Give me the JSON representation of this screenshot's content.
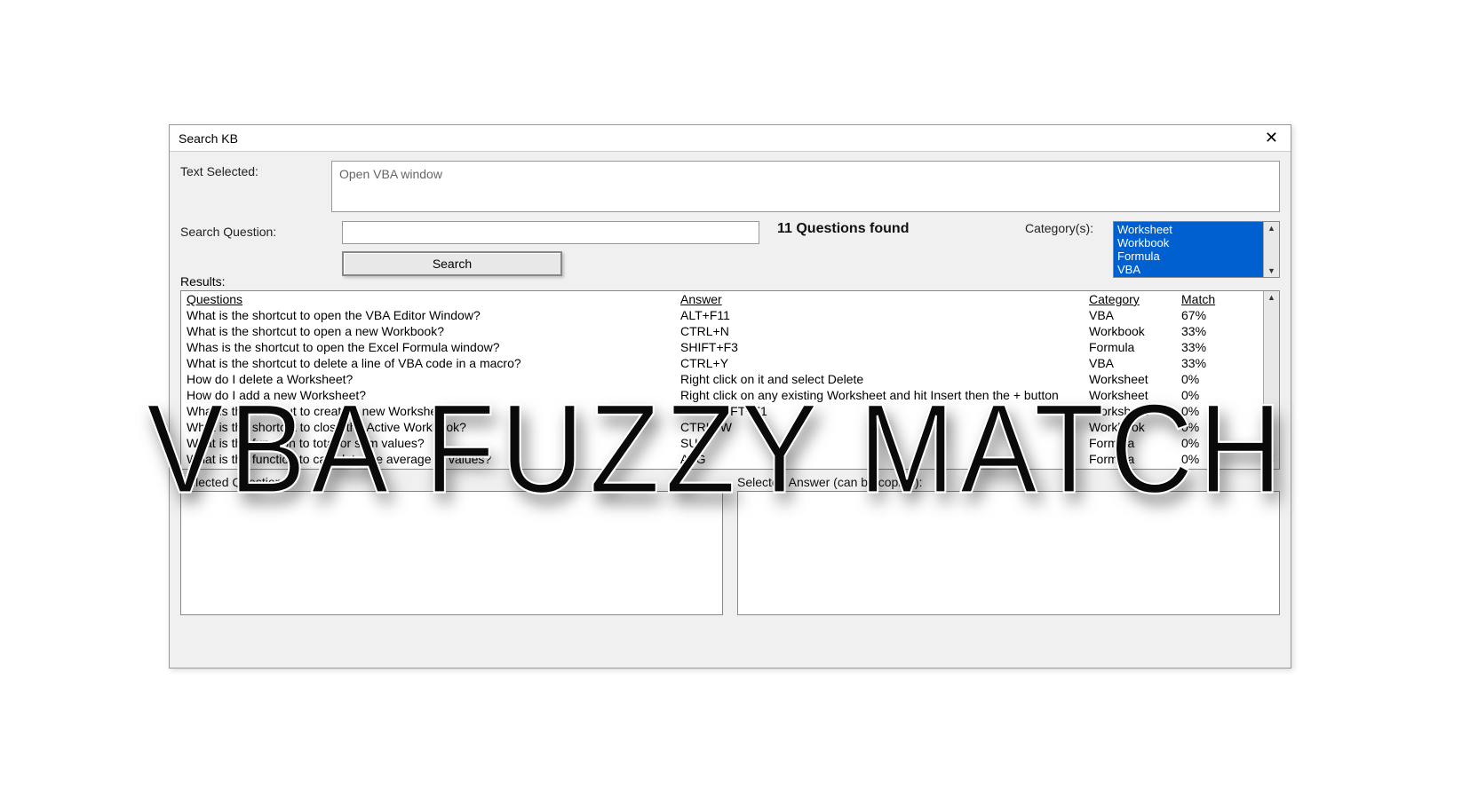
{
  "window": {
    "title": "Search KB"
  },
  "labels": {
    "text_selected": "Text Selected:",
    "search_question": "Search Question:",
    "category": "Category(s):",
    "results": "Results:",
    "selected_question": "Selected Question:",
    "selected_answer": "Selected Answer (can be copied):"
  },
  "text_selected_value": "Open VBA window",
  "search_question_value": "",
  "questions_found": "11 Questions found",
  "search_button": "Search",
  "categories": [
    "Worksheet",
    "Workbook",
    "Formula",
    "VBA"
  ],
  "results_headers": {
    "q": "Questions",
    "a": "Answer",
    "c": "Category",
    "m": "Match"
  },
  "results": [
    {
      "q": "What is the shortcut to open the VBA Editor Window?",
      "a": "ALT+F11",
      "c": "VBA",
      "m": "67%"
    },
    {
      "q": "What is the shortcut to open a new Workbook?",
      "a": "CTRL+N",
      "c": "Workbook",
      "m": "33%"
    },
    {
      "q": "Whas is the shortcut to open the Excel Formula window?",
      "a": "SHIFT+F3",
      "c": "Formula",
      "m": "33%"
    },
    {
      "q": "What is the shortcut to delete a line of VBA code in a macro?",
      "a": "CTRL+Y",
      "c": "VBA",
      "m": "33%"
    },
    {
      "q": "How do I delete a Worksheet?",
      "a": "Right click on it and select Delete",
      "c": "Worksheet",
      "m": "0%"
    },
    {
      "q": "How do I add a new Worksheet?",
      "a": "Right click on any existing Worksheet and hit Insert then the + button",
      "c": "Worksheet",
      "m": "0%"
    },
    {
      "q": "What is the shortcut to create a new Worksheet?",
      "a": "ALT+SHIFT+F1",
      "c": "Worksheet",
      "m": "0%"
    },
    {
      "q": "What is the shortcut to close the Active Workbook?",
      "a": "CTRL+W",
      "c": "Workbook",
      "m": "0%"
    },
    {
      "q": "What is the function to total or sum values?",
      "a": "SUM",
      "c": "Formula",
      "m": "0%"
    },
    {
      "q": "What is the function to calculate the average of values?",
      "a": "AVG",
      "c": "Formula",
      "m": "0%"
    }
  ],
  "overlay": "VBA FUZZY MATCH"
}
